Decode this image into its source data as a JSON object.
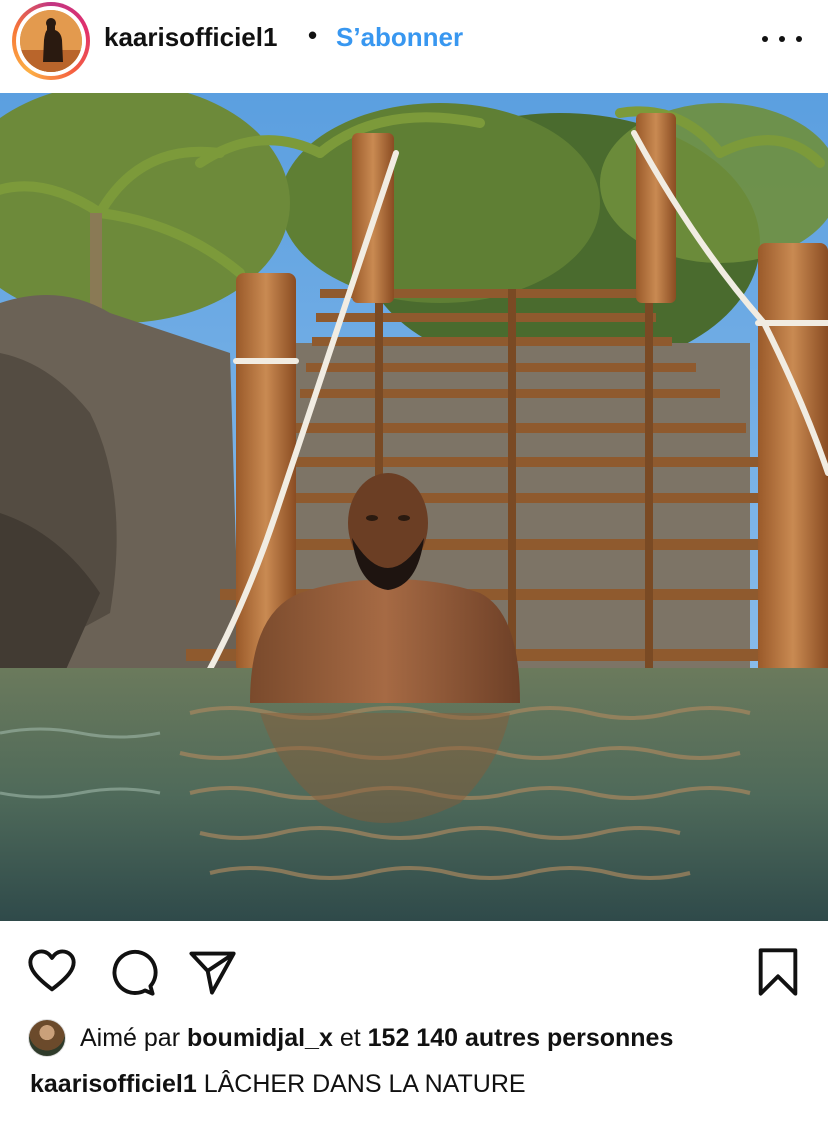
{
  "header": {
    "username": "kaarisofficiel1",
    "separator": "•",
    "follow_label": "S’abonner",
    "more_icon": "more-horizontal-icon"
  },
  "post": {
    "image_alt": "Man standing in clear water in front of wooden stairs with ropes, palm trees and blue sky"
  },
  "actions": {
    "like_icon": "heart-icon",
    "comment_icon": "comment-icon",
    "share_icon": "send-icon",
    "save_icon": "bookmark-icon"
  },
  "likes": {
    "prefix": "Aimé par",
    "liker": "boumidjal_x",
    "connector": "et",
    "count_text": "152 140 autres personnes"
  },
  "caption": {
    "username": "kaarisofficiel1",
    "text": "LÂCHER DANS LA NATURE"
  },
  "colors": {
    "follow_blue": "#3897f0",
    "text": "#111111"
  }
}
